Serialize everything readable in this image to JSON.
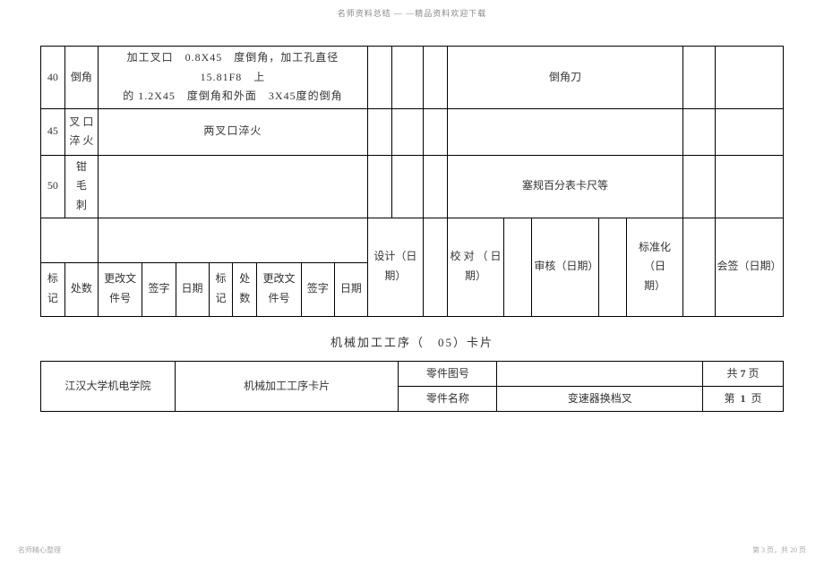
{
  "header": {
    "top_text": "名师资料总结 — —精品资料欢迎下载"
  },
  "table1": {
    "row40": {
      "num": "40",
      "name": "倒角",
      "desc_line1": "加工叉口　0.8X45　度倒角，加工孔直径　15.81F8　上",
      "desc_line2": "的 1.2X45　度倒角和外面　3X45度的倒角",
      "tool": "倒角刀"
    },
    "row45": {
      "num": "45",
      "name_line1": "叉 口",
      "name_line2": "淬 火",
      "desc": "两叉口淬火"
    },
    "row50": {
      "num": "50",
      "name_line1": "钳　毛",
      "name_line2": "刺",
      "tool": "塞规百分表卡尺等"
    },
    "approvals": {
      "design": "设计（日期）",
      "proof_line1": "校 对 （ 日",
      "proof_line2": "期）",
      "check": "审核（日期）",
      "std_line1": "标准化（日",
      "std_line2": "期）",
      "sign": "会签（日期）"
    },
    "bottom_headers": {
      "mark": "标记",
      "count": "处数",
      "change_doc": "更改文件号",
      "signature": "签字",
      "date": "日期",
      "mark2": "标记",
      "count2": "处数",
      "change_doc2": "更改文件号",
      "signature2": "签字",
      "date2": "日期"
    }
  },
  "midtitle": "机械加工工序（　05）卡片",
  "table2": {
    "institute": "江汉大学机电学院",
    "card": "机械加工工序卡片",
    "part_drawing_label": "零件图号",
    "part_name_label": "零件名称",
    "part_name_value": "变速器换档叉",
    "total_pages_prefix": "共",
    "total_pages_num": "7",
    "total_pages_suffix": "页",
    "page_prefix": "第",
    "page_num": "1",
    "page_suffix": "页"
  },
  "footer": {
    "left": "名师精心整理",
    "right": "第 3 页，共 20 页"
  }
}
